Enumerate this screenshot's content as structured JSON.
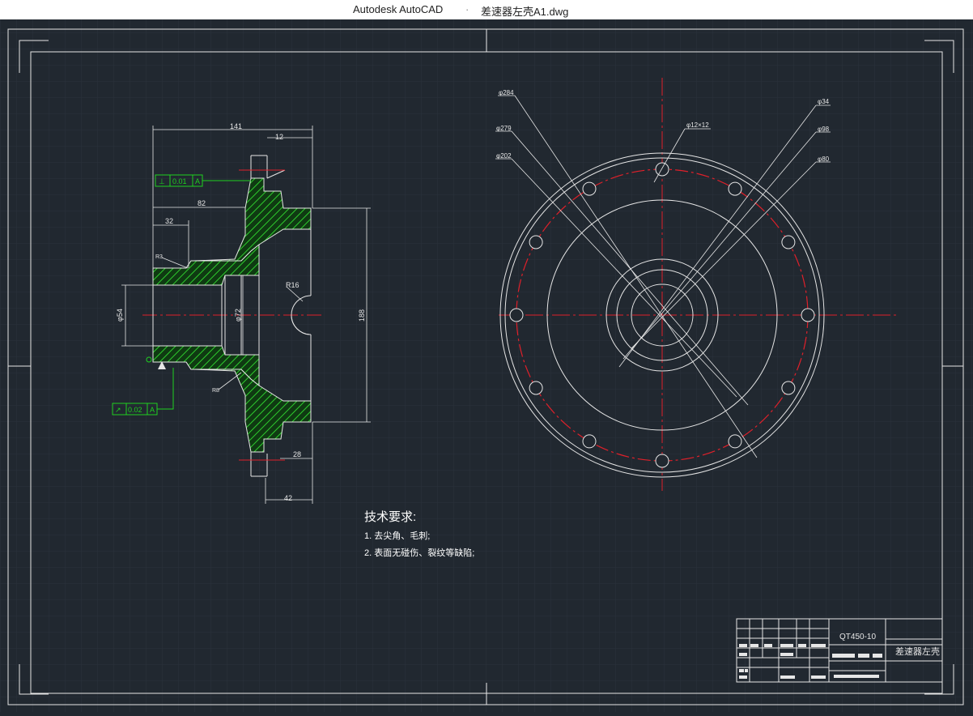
{
  "window": {
    "app_name": "Autodesk AutoCAD",
    "separator": "·",
    "file_name": "差速器左壳A1.dwg"
  },
  "drawing": {
    "section_view": {
      "dims": {
        "d141": "141",
        "d12": "12",
        "d82": "82",
        "d32": "32",
        "r3": "R3",
        "r8": "R8",
        "r16": "R16",
        "phi54": "φ54",
        "phi72": "φ72",
        "d188": "188",
        "d28": "28",
        "d42": "42"
      },
      "tolerances": {
        "top": {
          "symbol": "⊥",
          "value": "0.01",
          "datum": "A"
        },
        "bottom": {
          "symbol": "↗",
          "value": "0.02",
          "datum": "A"
        }
      }
    },
    "front_view": {
      "labels": {
        "phi284": "φ284",
        "phi279": "φ279",
        "phi202": "φ202",
        "holes": "φ12×12",
        "phi34": "φ34",
        "phi98": "φ98",
        "phi80": "φ80"
      }
    },
    "notes": {
      "title": "技术要求:",
      "items": [
        "1. 去尖角、毛刺;",
        "2. 表面无碰伤、裂纹等缺陷;"
      ]
    },
    "title_block": {
      "material": "QT450-10",
      "part_name": "差速器左壳"
    }
  },
  "colors": {
    "background": "#212830",
    "line": "#e6e6e6",
    "centerline": "#e0202a",
    "hatch": "#1fa51f",
    "tolerance": "#1fd11f"
  }
}
